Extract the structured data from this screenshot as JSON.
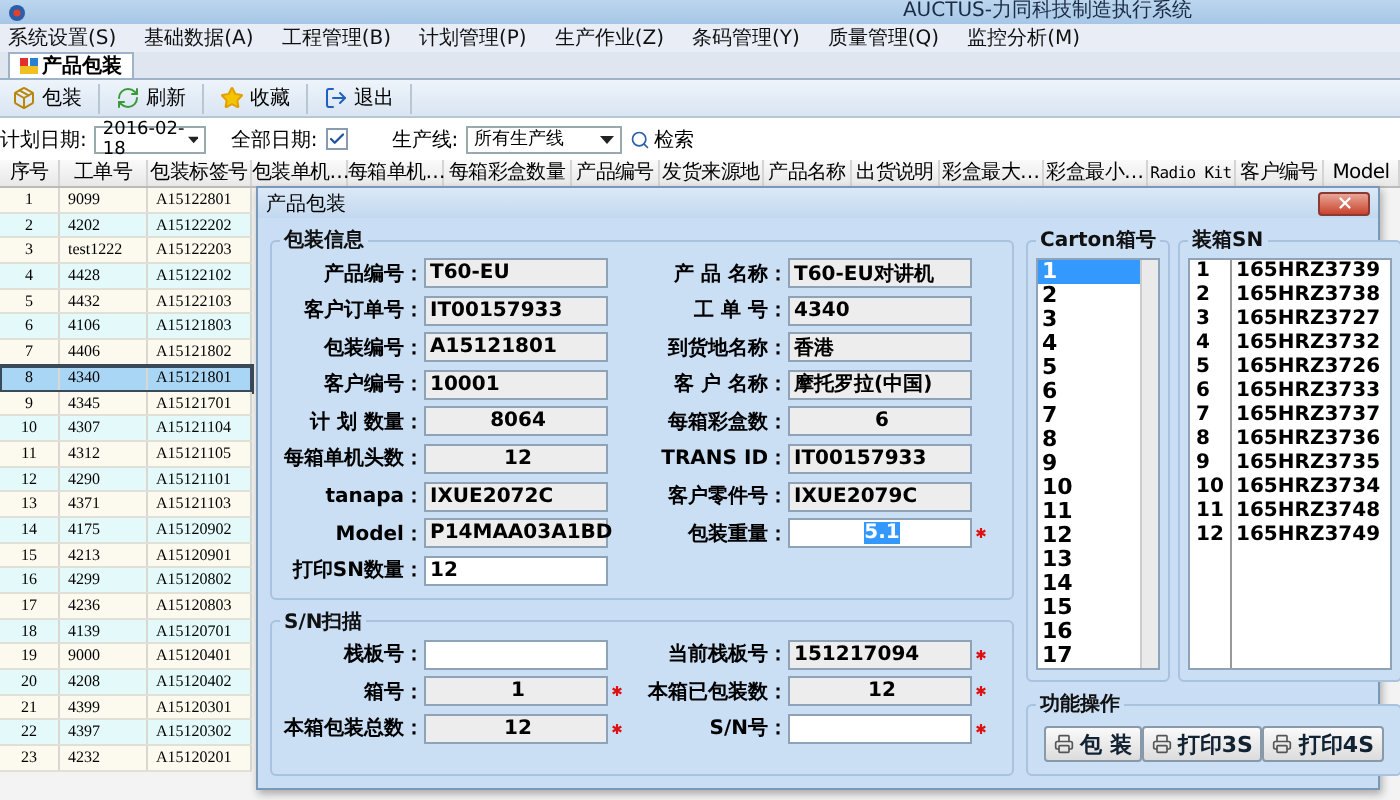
{
  "window": {
    "title": "AUCTUS-力同科技制造执行系统"
  },
  "menu": [
    "系统设置(S)",
    "基础数据(A)",
    "工程管理(B)",
    "计划管理(P)",
    "生产作业(Z)",
    "条码管理(Y)",
    "质量管理(Q)",
    "监控分析(M)"
  ],
  "tabs": [
    {
      "label": "产品包装",
      "selected": true
    }
  ],
  "toolbar": [
    {
      "kind": "pack",
      "label": "包装"
    },
    {
      "kind": "refresh",
      "label": "刷新"
    },
    {
      "kind": "favorite",
      "label": "收藏"
    },
    {
      "kind": "exit",
      "label": "退出"
    }
  ],
  "filter": {
    "date_label": "计划日期:",
    "date": "2016-02-18",
    "all_dates_label": "全部日期:",
    "all_dates_checked": true,
    "line_label": "生产线:",
    "line": "所有生产线",
    "search": "检索"
  },
  "table": {
    "columns": [
      "序号",
      "工单号",
      "包装标签号",
      "包装单机…",
      "每箱单机…",
      "每箱彩盒数量",
      "产品编号",
      "发货来源地",
      "产品名称",
      "出货说明",
      "彩盒最大…",
      "彩盒最小…",
      "Radio Kit",
      "客户编号",
      "Model"
    ],
    "rows": [
      {
        "cells": [
          "1",
          "9099",
          "A15122801"
        ],
        "selected": false
      },
      {
        "cells": [
          "2",
          "4202",
          "A15122202"
        ],
        "selected": false
      },
      {
        "cells": [
          "3",
          "test1222",
          "A15122203"
        ],
        "selected": false
      },
      {
        "cells": [
          "4",
          "4428",
          "A15122102"
        ],
        "selected": false
      },
      {
        "cells": [
          "5",
          "4432",
          "A15122103"
        ],
        "selected": false
      },
      {
        "cells": [
          "6",
          "4106",
          "A15121803"
        ],
        "selected": false
      },
      {
        "cells": [
          "7",
          "4406",
          "A15121802"
        ],
        "selected": false
      },
      {
        "cells": [
          "8",
          "4340",
          "A15121801"
        ],
        "selected": true
      },
      {
        "cells": [
          "9",
          "4345",
          "A15121701"
        ],
        "selected": false
      },
      {
        "cells": [
          "10",
          "4307",
          "A15121104"
        ],
        "selected": false
      },
      {
        "cells": [
          "11",
          "4312",
          "A15121105"
        ],
        "selected": false
      },
      {
        "cells": [
          "12",
          "4290",
          "A15121101"
        ],
        "selected": false
      },
      {
        "cells": [
          "13",
          "4371",
          "A15121103"
        ],
        "selected": false
      },
      {
        "cells": [
          "14",
          "4175",
          "A15120902"
        ],
        "selected": false
      },
      {
        "cells": [
          "15",
          "4213",
          "A15120901"
        ],
        "selected": false
      },
      {
        "cells": [
          "16",
          "4299",
          "A15120802"
        ],
        "selected": false
      },
      {
        "cells": [
          "17",
          "4236",
          "A15120803"
        ],
        "selected": false
      },
      {
        "cells": [
          "18",
          "4139",
          "A15120701"
        ],
        "selected": false
      },
      {
        "cells": [
          "19",
          "9000",
          "A15120401"
        ],
        "selected": false
      },
      {
        "cells": [
          "20",
          "4208",
          "A15120402"
        ],
        "selected": false
      },
      {
        "cells": [
          "21",
          "4399",
          "A15120301"
        ],
        "selected": false
      },
      {
        "cells": [
          "22",
          "4397",
          "A15120302"
        ],
        "selected": false
      },
      {
        "cells": [
          "23",
          "4232",
          "A15120201"
        ],
        "selected": false
      }
    ]
  },
  "dialog": {
    "title": "产品包装",
    "pack_info": {
      "title": "包装信息",
      "fields": [
        {
          "label": "产品编号：",
          "value": "T60-EU",
          "editable": false,
          "centered": false,
          "required": false,
          "selected": false
        },
        {
          "label": "产 品 名称：",
          "value": "T60-EU对讲机",
          "editable": false,
          "centered": false,
          "required": false,
          "selected": false
        },
        {
          "label": "客户订单号：",
          "value": "IT00157933",
          "editable": false,
          "centered": false,
          "required": false,
          "selected": false
        },
        {
          "label": "工 单 号：",
          "value": "4340",
          "editable": false,
          "centered": false,
          "required": false,
          "selected": false
        },
        {
          "label": "包装编号：",
          "value": "A15121801",
          "editable": false,
          "centered": false,
          "required": false,
          "selected": false
        },
        {
          "label": "到货地名称：",
          "value": "香港",
          "editable": false,
          "centered": false,
          "required": false,
          "selected": false
        },
        {
          "label": "客户编号：",
          "value": "10001",
          "editable": false,
          "centered": false,
          "required": false,
          "selected": false
        },
        {
          "label": "客 户 名称：",
          "value": "摩托罗拉(中国)",
          "editable": false,
          "centered": false,
          "required": false,
          "selected": false
        },
        {
          "label": "计 划 数量：",
          "value": "8064",
          "editable": false,
          "centered": true,
          "required": false,
          "selected": false
        },
        {
          "label": "每箱彩盒数：",
          "value": "6",
          "editable": false,
          "centered": true,
          "required": false,
          "selected": false
        },
        {
          "label": "每箱单机头数：",
          "value": "12",
          "editable": false,
          "centered": true,
          "required": false,
          "selected": false
        },
        {
          "label": "TRANS ID：",
          "value": "IT00157933",
          "editable": false,
          "centered": false,
          "required": false,
          "selected": false
        },
        {
          "label": "tanapa：",
          "value": "IXUE2072C",
          "editable": false,
          "centered": false,
          "required": false,
          "selected": false
        },
        {
          "label": "客户零件号：",
          "value": "IXUE2079C",
          "editable": false,
          "centered": false,
          "required": false,
          "selected": false
        },
        {
          "label": "Model：",
          "value": "P14MAA03A1BD",
          "editable": false,
          "centered": false,
          "required": false,
          "selected": false
        },
        {
          "label": "包装重量：",
          "value": "5.1",
          "editable": true,
          "centered": true,
          "required": true,
          "selected": true
        },
        {
          "label": "打印SN数量：",
          "value": "12",
          "editable": true,
          "centered": false,
          "required": false,
          "selected": false
        }
      ]
    },
    "sn_scan": {
      "title": "S/N扫描",
      "fields": [
        {
          "label": "栈板号：",
          "editable": true,
          "centered": false,
          "required": false
        },
        {
          "label": "当前栈板号：",
          "value": "151217094",
          "editable": false,
          "centered": false,
          "required": true,
          "selected": false
        },
        {
          "label": "箱号：",
          "value": "1",
          "editable": false,
          "centered": true,
          "required": true,
          "selected": false
        },
        {
          "label": "本箱已包装数：",
          "value": "12",
          "editable": false,
          "centered": true,
          "required": true,
          "selected": false
        },
        {
          "label": "本箱包装总数：",
          "value": "12",
          "editable": false,
          "centered": true,
          "required": true,
          "selected": false
        },
        {
          "label": "S/N号：",
          "editable": true,
          "centered": false,
          "required": true
        }
      ]
    },
    "cartons": {
      "title": "Carton箱号",
      "items": [
        {
          "label": "1",
          "selected": true
        },
        {
          "label": "2",
          "selected": false
        },
        {
          "label": "3",
          "selected": false
        },
        {
          "label": "4",
          "selected": false
        },
        {
          "label": "5",
          "selected": false
        },
        {
          "label": "6",
          "selected": false
        },
        {
          "label": "7",
          "selected": false
        },
        {
          "label": "8",
          "selected": false
        },
        {
          "label": "9",
          "selected": false
        },
        {
          "label": "10",
          "selected": false
        },
        {
          "label": "11",
          "selected": false
        },
        {
          "label": "12",
          "selected": false
        },
        {
          "label": "13",
          "selected": false
        },
        {
          "label": "14",
          "selected": false
        },
        {
          "label": "15",
          "selected": false
        },
        {
          "label": "16",
          "selected": false
        },
        {
          "label": "17",
          "selected": false
        }
      ]
    },
    "packed_sn": {
      "title": "装箱SN",
      "rows": [
        [
          "1",
          "165HRZ3739"
        ],
        [
          "2",
          "165HRZ3738"
        ],
        [
          "3",
          "165HRZ3727"
        ],
        [
          "4",
          "165HRZ3732"
        ],
        [
          "5",
          "165HRZ3726"
        ],
        [
          "6",
          "165HRZ3733"
        ],
        [
          "7",
          "165HRZ3737"
        ],
        [
          "8",
          "165HRZ3736"
        ],
        [
          "9",
          "165HRZ3735"
        ],
        [
          "10",
          "165HRZ3734"
        ],
        [
          "11",
          "165HRZ3748"
        ],
        [
          "12",
          "165HRZ3749"
        ]
      ]
    },
    "actions": {
      "title": "功能操作",
      "buttons": [
        "包 装",
        "打印3S",
        "打印4S"
      ]
    }
  }
}
